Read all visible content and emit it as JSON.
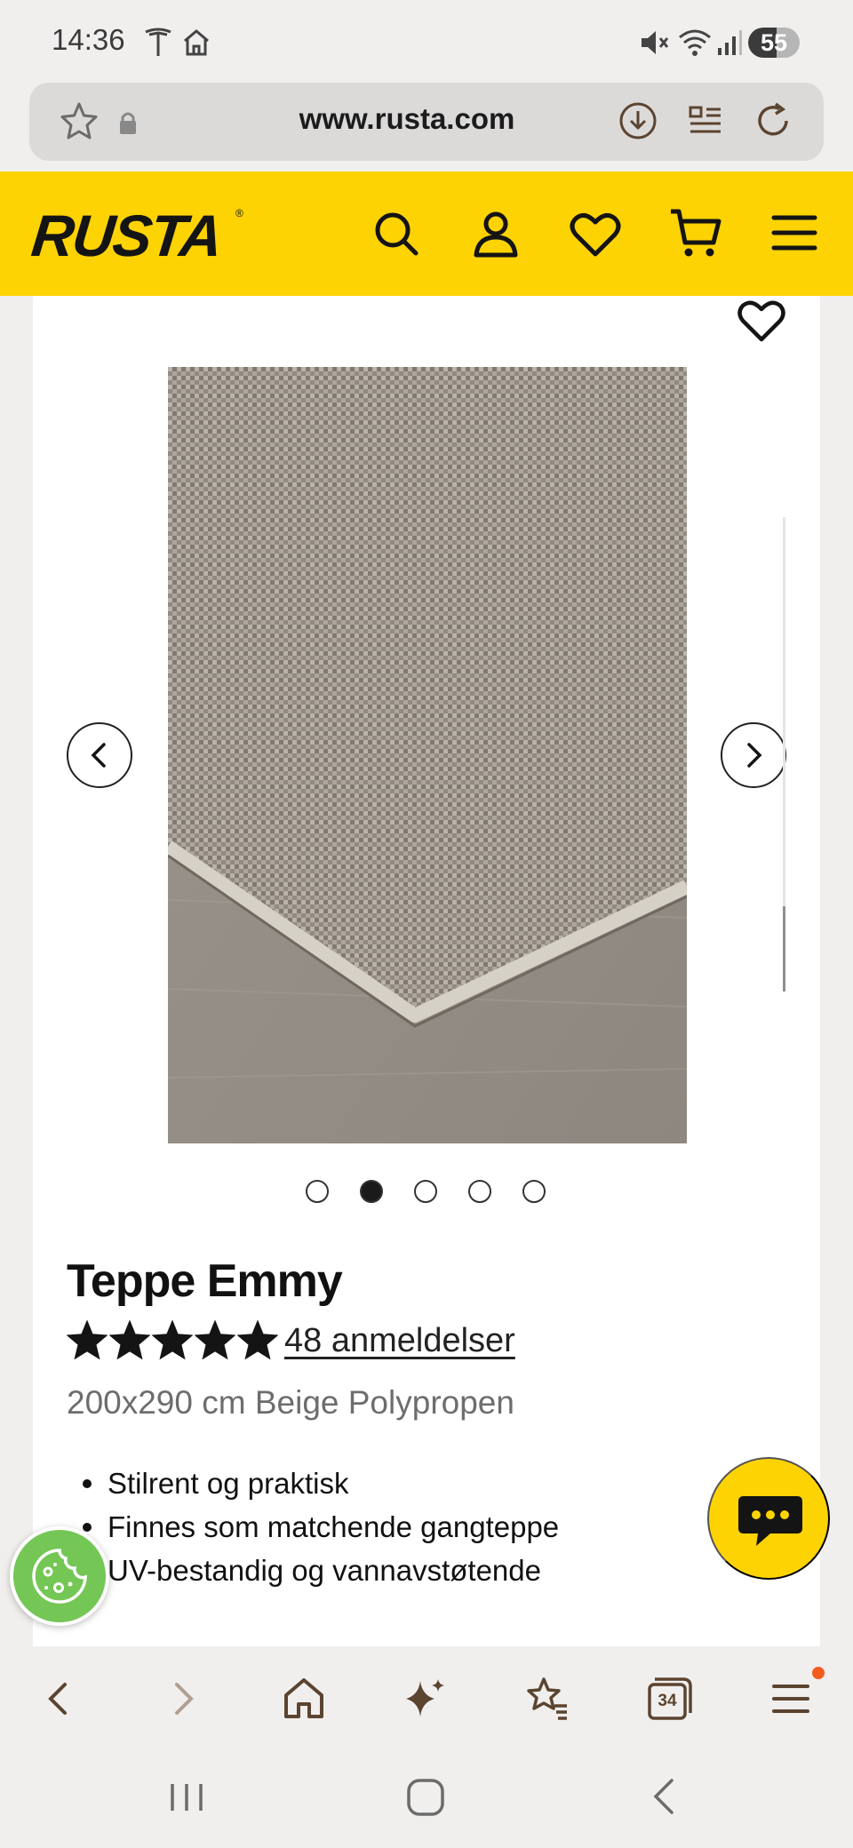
{
  "status_bar": {
    "time": "14:36",
    "battery_text": "55",
    "battery_level": 0.55,
    "icons": [
      "tesla-icon",
      "home-icon",
      "mute-icon",
      "wifi-icon",
      "signal-icon",
      "battery-icon"
    ]
  },
  "browser": {
    "url": "www.rusta.com",
    "icons": [
      "favorite-star-icon",
      "lock-icon",
      "download-icon",
      "reader-icon",
      "reload-icon"
    ]
  },
  "site_header": {
    "logo": "RUSTA",
    "icons": [
      "search-icon",
      "account-icon",
      "wishlist-heart-icon",
      "cart-icon",
      "menu-icon"
    ]
  },
  "product": {
    "title": "Teppe Emmy",
    "rating": 5,
    "rating_max": 5,
    "reviews_link": "48 anmeldelser",
    "subtitle": "200x290 cm Beige Polypropen",
    "features": [
      "Stilrent og praktisk",
      "Finnes som matchende gangteppe",
      "UV-bestandig og vannavstøtende"
    ],
    "gallery": {
      "image_count": 5,
      "active_index": 1
    }
  },
  "browser_toolbar": {
    "tabs_count": "34",
    "icons": [
      "back-icon",
      "forward-icon",
      "home-icon",
      "sparkle-icon",
      "bookmarks-icon",
      "tabs-icon",
      "menu-icon"
    ]
  },
  "colors": {
    "brand_yellow": "#fdd304",
    "cookie_green": "#74c655",
    "toolbar_brown": "#5b4430",
    "notification_orange": "#f25c1f"
  }
}
